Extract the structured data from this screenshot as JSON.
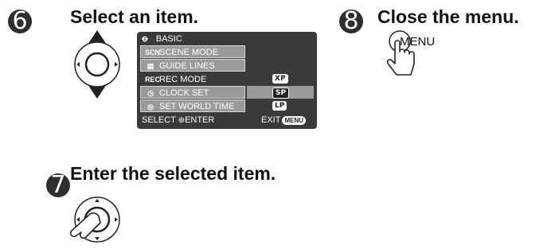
{
  "steps": [
    {
      "number": "6",
      "title": "Select an item."
    },
    {
      "number": "8",
      "title": "Close the menu."
    },
    {
      "number": "7",
      "title": "Enter the selected item."
    }
  ],
  "menu": {
    "header": "BASIC",
    "items": [
      {
        "icon": "SCN",
        "label": "SCENE MODE"
      },
      {
        "icon": "▤",
        "label": "GUIDE LINES"
      },
      {
        "icon": "REC",
        "label": "REC MODE"
      },
      {
        "icon": "◷",
        "label": "CLOCK SET"
      },
      {
        "icon": "◎",
        "label": "SET WORLD TIME"
      }
    ],
    "values": [
      "XP",
      "SP",
      "LP"
    ],
    "footer_select": "SELECT",
    "footer_enter": "ENTER",
    "footer_exit": "EXIT",
    "footer_menu_badge": "MENU"
  },
  "close_button_label": "MENU",
  "icons": [
    "up-down-dial-icon",
    "press-dial-icon",
    "menu-button-hand-icon",
    "joystick-icon"
  ],
  "colors": {
    "menu_bg": "#3a3a3a",
    "menu_item": "#9a9a9a",
    "step_circle": "#2f2f2f"
  }
}
